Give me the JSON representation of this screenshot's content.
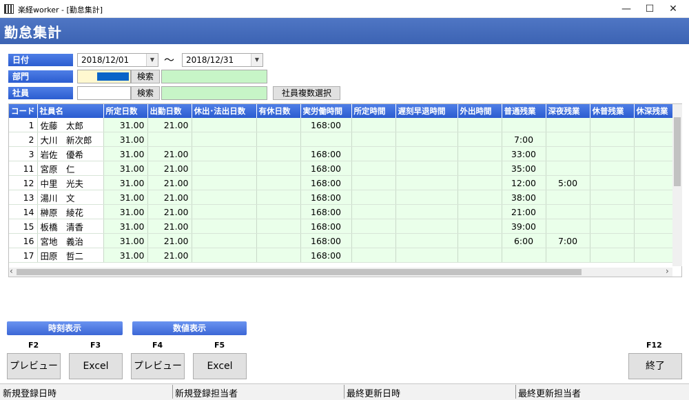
{
  "window": {
    "title": "楽経worker - [勤怠集計]",
    "minimize": "—",
    "maximize": "☐",
    "close": "✕"
  },
  "page": {
    "title": "勤怠集計"
  },
  "filters": {
    "date_label": "日付",
    "date_from": "2018/12/01",
    "date_sep": "～",
    "date_to": "2018/12/31",
    "dept_label": "部門",
    "emp_label": "社員",
    "search_label": "検索",
    "multi_select_label": "社員複数選択"
  },
  "grid": {
    "columns": [
      "コード",
      "社員名",
      "所定日数",
      "出勤日数",
      "休出･法出日数",
      "有休日数",
      "実労働時間",
      "所定時間",
      "遅刻早退時間",
      "外出時間",
      "普通残業",
      "深夜残業",
      "休普残業",
      "休深残業"
    ],
    "rows": [
      {
        "code": "1",
        "name": "佐藤　太郎",
        "c3": "31.00",
        "c4": "21.00",
        "c5": "",
        "c6": "",
        "c7": "168:00",
        "c8": "",
        "c9": "",
        "c10": "",
        "c11": "",
        "c12": "",
        "c13": "",
        "c14": ""
      },
      {
        "code": "2",
        "name": "大川　新次郎",
        "c3": "31.00",
        "c4": "",
        "c5": "",
        "c6": "",
        "c7": "",
        "c8": "",
        "c9": "",
        "c10": "",
        "c11": "7:00",
        "c12": "",
        "c13": "",
        "c14": ""
      },
      {
        "code": "3",
        "name": "岩佐　優希",
        "c3": "31.00",
        "c4": "21.00",
        "c5": "",
        "c6": "",
        "c7": "168:00",
        "c8": "",
        "c9": "",
        "c10": "",
        "c11": "33:00",
        "c12": "",
        "c13": "",
        "c14": ""
      },
      {
        "code": "11",
        "name": "宮原　仁",
        "c3": "31.00",
        "c4": "21.00",
        "c5": "",
        "c6": "",
        "c7": "168:00",
        "c8": "",
        "c9": "",
        "c10": "",
        "c11": "35:00",
        "c12": "",
        "c13": "",
        "c14": ""
      },
      {
        "code": "12",
        "name": "中里　光夫",
        "c3": "31.00",
        "c4": "21.00",
        "c5": "",
        "c6": "",
        "c7": "168:00",
        "c8": "",
        "c9": "",
        "c10": "",
        "c11": "12:00",
        "c12": "5:00",
        "c13": "",
        "c14": ""
      },
      {
        "code": "13",
        "name": "湯川　文",
        "c3": "31.00",
        "c4": "21.00",
        "c5": "",
        "c6": "",
        "c7": "168:00",
        "c8": "",
        "c9": "",
        "c10": "",
        "c11": "38:00",
        "c12": "",
        "c13": "",
        "c14": ""
      },
      {
        "code": "14",
        "name": "榊原　綾花",
        "c3": "31.00",
        "c4": "21.00",
        "c5": "",
        "c6": "",
        "c7": "168:00",
        "c8": "",
        "c9": "",
        "c10": "",
        "c11": "21:00",
        "c12": "",
        "c13": "",
        "c14": ""
      },
      {
        "code": "15",
        "name": "板橋　清香",
        "c3": "31.00",
        "c4": "21.00",
        "c5": "",
        "c6": "",
        "c7": "168:00",
        "c8": "",
        "c9": "",
        "c10": "",
        "c11": "39:00",
        "c12": "",
        "c13": "",
        "c14": ""
      },
      {
        "code": "16",
        "name": "宮地　義治",
        "c3": "31.00",
        "c4": "21.00",
        "c5": "",
        "c6": "",
        "c7": "168:00",
        "c8": "",
        "c9": "",
        "c10": "",
        "c11": "6:00",
        "c12": "7:00",
        "c13": "",
        "c14": ""
      },
      {
        "code": "17",
        "name": "田原　哲二",
        "c3": "31.00",
        "c4": "21.00",
        "c5": "",
        "c6": "",
        "c7": "168:00",
        "c8": "",
        "c9": "",
        "c10": "",
        "c11": "",
        "c12": "",
        "c13": "",
        "c14": ""
      }
    ]
  },
  "scroll": {
    "left_arrow": "‹",
    "right_arrow": "›"
  },
  "modes": {
    "time_display": "時刻表示",
    "value_display": "数値表示"
  },
  "fkeys": {
    "f2": {
      "key": "F2",
      "label": "プレビュー"
    },
    "f3": {
      "key": "F3",
      "label": "Excel"
    },
    "f4": {
      "key": "F4",
      "label": "プレビュー"
    },
    "f5": {
      "key": "F5",
      "label": "Excel"
    },
    "f12": {
      "key": "F12",
      "label": "終了"
    }
  },
  "status": {
    "created_at": "新規登録日時",
    "created_by": "新規登録担当者",
    "updated_at": "最終更新日時",
    "updated_by": "最終更新担当者"
  }
}
